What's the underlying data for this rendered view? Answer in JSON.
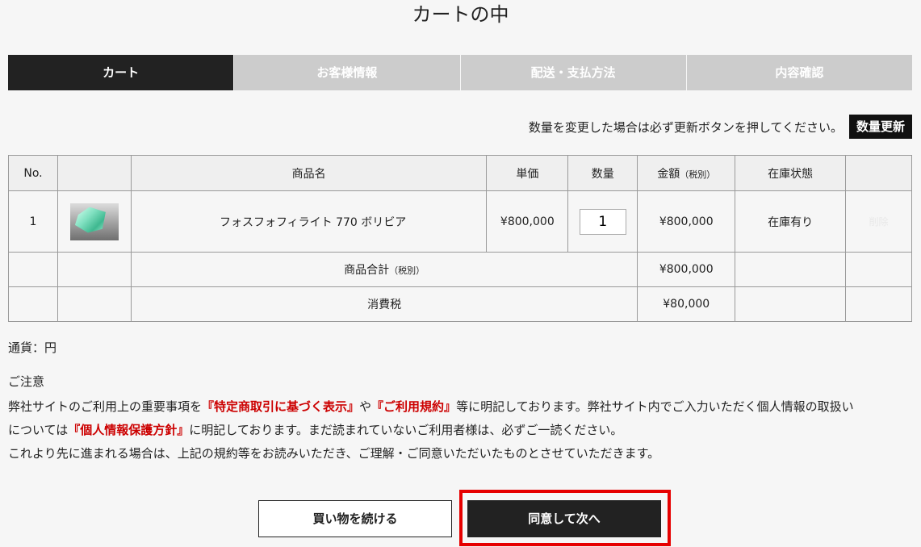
{
  "page_title": "カートの中",
  "steps": [
    {
      "label": "カート",
      "active": true
    },
    {
      "label": "お客様情報",
      "active": false
    },
    {
      "label": "配送・支払方法",
      "active": false
    },
    {
      "label": "内容確認",
      "active": false
    }
  ],
  "update": {
    "note": "数量を変更した場合は必ず更新ボタンを押してください。",
    "button_label": "数量更新"
  },
  "table": {
    "headers": {
      "no": "No.",
      "image": "",
      "name": "商品名",
      "unit_price": "単価",
      "quantity": "数量",
      "amount": "金額",
      "amount_note": "（税別）",
      "stock": "在庫状態",
      "action": ""
    },
    "items": [
      {
        "no": "1",
        "name": "フォスフォフィライト 770 ボリビア",
        "unit_price": "¥800,000",
        "quantity": "1",
        "amount": "¥800,000",
        "stock": "在庫有り",
        "delete_label": "削除"
      }
    ],
    "subtotal": {
      "label": "商品合計",
      "note": "（税別）",
      "value": "¥800,000"
    },
    "tax": {
      "label": "消費税",
      "value": "¥80,000"
    }
  },
  "currency_text": "通貨：円",
  "notice": {
    "title": "ご注意",
    "line1_a": "弊社サイトのご利用上の重要事項を",
    "link_tokutei": "『特定商取引に基づく表示』",
    "line1_b": "や",
    "link_terms": "『ご利用規約』",
    "line1_c": "等に明記しております。弊社サイト内でご入力いただく個人情報の取扱い",
    "line2_a": "については",
    "link_privacy": "『個人情報保護方針』",
    "line2_b": "に明記しております。まだ読まれていないご利用者様は、必ずご一読ください。",
    "line3": "これより先に進まれる場合は、上記の規約等をお読みいただき、ご理解・ご同意いただいたものとさせていただきます。"
  },
  "buttons": {
    "continue_shopping": "買い物を続ける",
    "agree_next": "同意して次へ"
  },
  "colors": {
    "active_step": "#222222",
    "inactive_step": "#cccccc",
    "link_red": "#cc0000",
    "highlight_red": "#e60000"
  }
}
